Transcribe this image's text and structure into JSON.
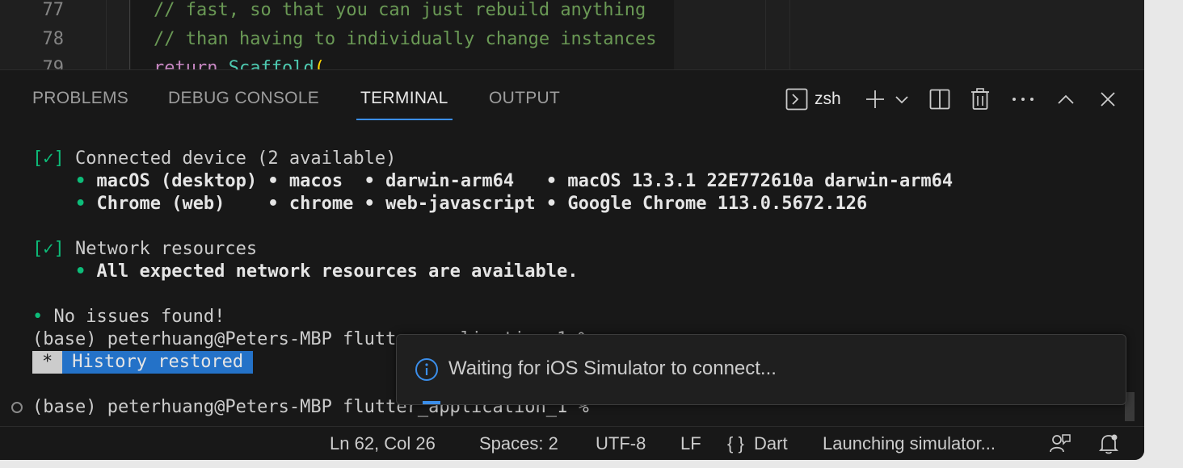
{
  "editor": {
    "lines": [
      {
        "num": "77",
        "text": "// fast, so that you can just rebuild anything"
      },
      {
        "num": "78",
        "text": "// than having to individually change instances"
      },
      {
        "num": "79",
        "keyword": "return",
        "cls": "Scaffold",
        "paren": "("
      }
    ]
  },
  "panel": {
    "tabs": [
      "PROBLEMS",
      "DEBUG CONSOLE",
      "TERMINAL",
      "OUTPUT"
    ],
    "active_tab": "TERMINAL",
    "terminal_name": "zsh"
  },
  "terminal": {
    "check": "[✓]",
    "bullet": "•",
    "connected_title": "Connected device (2 available)",
    "devices": [
      {
        "name": "macOS (desktop)",
        "id": "macos ",
        "platform": "darwin-arm64  ",
        "info": "macOS 13.3.1 22E772610a darwin-arm64"
      },
      {
        "name": "Chrome (web)   ",
        "id": "chrome",
        "platform": "web-javascript",
        "info": "Google Chrome 113.0.5672.126"
      }
    ],
    "network_title": "Network resources",
    "network_detail": "All expected network resources are available.",
    "no_issues": "No issues found!",
    "prompt_line_1": "(base) peterhuang@Peters-MBP flutter_application_1 %",
    "history_star": "*",
    "history_text": "History restored",
    "prompt_line_2": "(base) peterhuang@Peters-MBP flutter_application_1 %"
  },
  "notification": {
    "message": "Waiting for iOS Simulator to connect..."
  },
  "statusbar": {
    "position": "Ln 62, Col 26",
    "spaces": "Spaces: 2",
    "encoding": "UTF-8",
    "eol": "LF",
    "language_icon": "{ }",
    "language": "Dart",
    "task": "Launching simulator..."
  },
  "colors": {
    "accent": "#3b8eea",
    "check_green": "#0dbc79",
    "history_bg": "#2472c8"
  }
}
